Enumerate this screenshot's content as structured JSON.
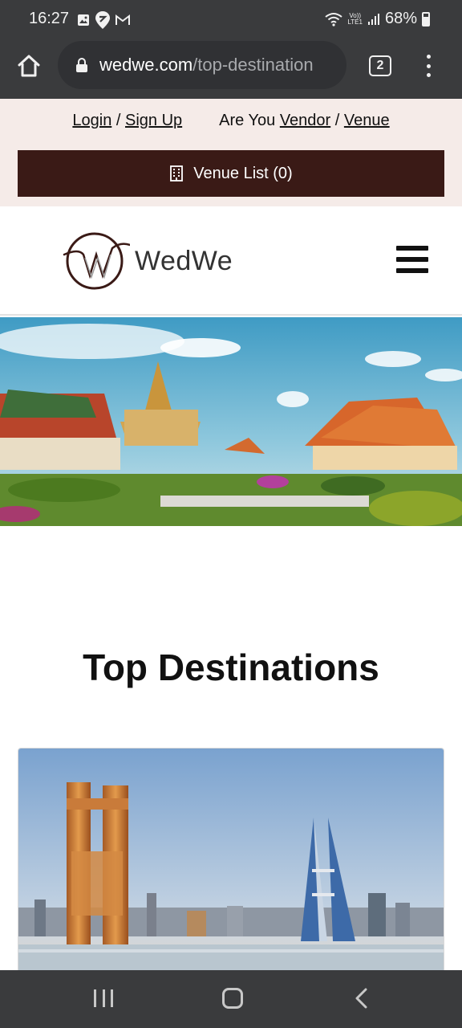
{
  "status_bar": {
    "time": "16:27",
    "battery": "68%",
    "network_label_top": "Vo))",
    "network_label_bottom": "LTE1"
  },
  "browser": {
    "url_domain": "wedwe.com",
    "url_path": "/top-destination",
    "tab_count": "2"
  },
  "top_bar": {
    "login": "Login",
    "separator": "/",
    "sign_up": "Sign Up",
    "vendor_prompt": "Are You",
    "vendor": "Vendor",
    "venue": "Venue",
    "venue_list_button": "Venue List (0)"
  },
  "header": {
    "logo_text": "WedWe"
  },
  "section": {
    "title_regular": "Top",
    "title_bold": "Destinations"
  },
  "colors": {
    "browser_chrome": "#3a3b3d",
    "top_bar_bg": "#f5ebe8",
    "accent_dark": "#3a1a16"
  },
  "icons": {
    "home": "home-icon",
    "lock": "lock-icon",
    "menu": "kebab-menu-icon",
    "building": "building-icon",
    "hamburger": "hamburger-menu-icon"
  }
}
